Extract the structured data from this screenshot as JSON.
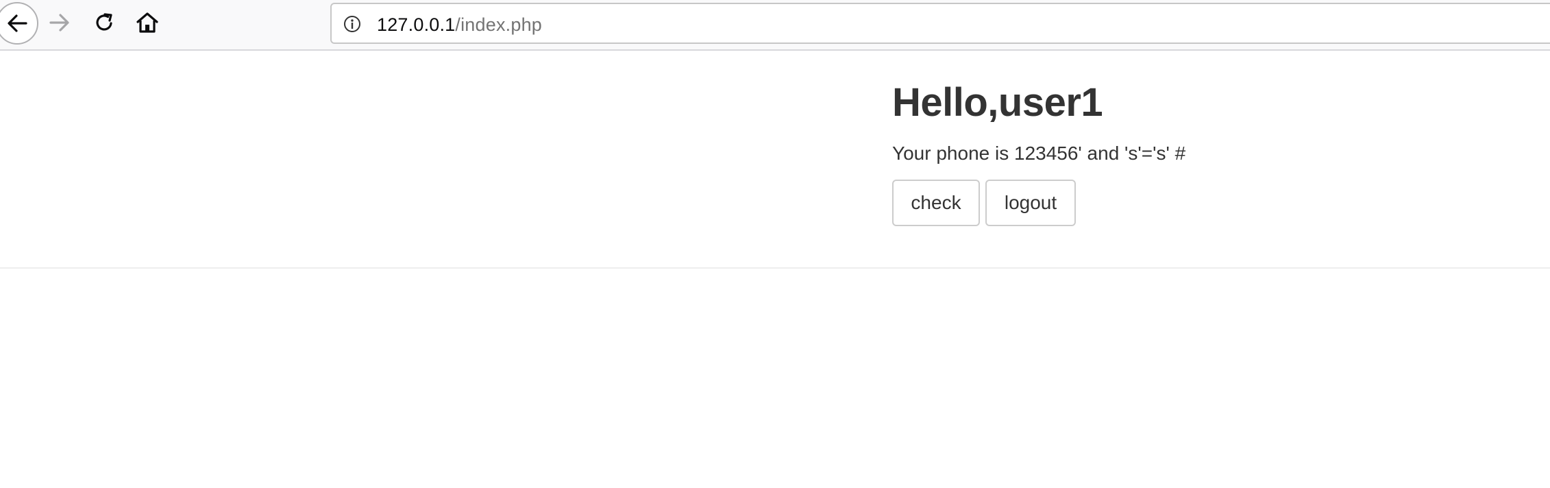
{
  "browser": {
    "url_host": "127.0.0.1",
    "url_path": "/index.php",
    "icons": [
      "back-icon",
      "forward-icon",
      "reload-icon",
      "home-icon",
      "info-icon"
    ]
  },
  "page": {
    "greeting": "Hello,user1",
    "phone_line": "Your phone is 123456' and 's'='s' #",
    "check_label": "check",
    "logout_label": "logout"
  }
}
